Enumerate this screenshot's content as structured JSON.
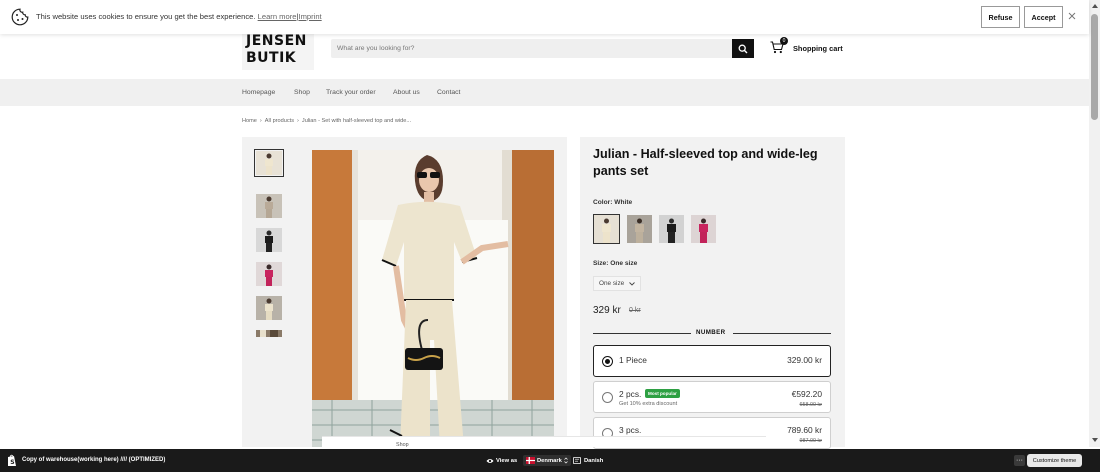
{
  "cookie_bar": {
    "message": "This website uses cookies to ensure you get the best experience.",
    "learn_more": "Learn more",
    "separator": "|",
    "imprint": "Imprint",
    "refuse": "Refuse",
    "accept": "Accept"
  },
  "header": {
    "logo_line1": "JENSEN",
    "logo_line2": "BUTIK",
    "search_placeholder": "What are you looking for?",
    "cart_label": "Shopping cart",
    "cart_count": "0"
  },
  "nav": {
    "items": [
      "Homepage",
      "Shop",
      "Track your order",
      "About us",
      "Contact"
    ]
  },
  "breadcrumb": {
    "items": [
      "Home",
      "All products",
      "Julian - Set with half-sleeved top and wide..."
    ],
    "separator": "›"
  },
  "product": {
    "title": "Julian - Half-sleeved top and wide-leg pants set",
    "color_label": "Color:",
    "color_value": "White",
    "size_label": "Size:",
    "size_value": "One size",
    "size_select": "One size",
    "price": "329 kr",
    "price_old": "0 kr",
    "number_heading": "NUMBER",
    "options": [
      {
        "label": "1 Piece",
        "price": "329.00 kr",
        "selected": true
      },
      {
        "label": "2 pcs.",
        "badge": "Most popular",
        "sub": "Get 10% extra discount",
        "price": "€592.20",
        "old": "658.00 kr"
      },
      {
        "label": "3 pcs.",
        "price": "789.60 kr",
        "old": "987.00 kr"
      }
    ]
  },
  "floating_bar": {
    "shop": "Shop"
  },
  "admin_bar": {
    "theme_name": "Copy of warehouse(working here) //// (OPTIMIZED)",
    "view_as": "View as",
    "country": "Denmark",
    "language": "Danish",
    "more": "···",
    "customize": "Customize theme"
  },
  "colors": {
    "admin_bg": "#1a1a1a",
    "badge_green": "#2ea043",
    "panel_bg": "#f2f2f2"
  }
}
